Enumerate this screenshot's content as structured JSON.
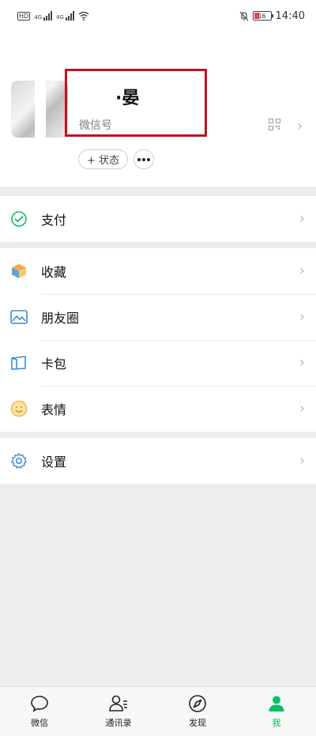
{
  "status_bar": {
    "network_badge": "HD",
    "signal_1": "4G",
    "signal_2": "4G",
    "battery": "16",
    "time": "14:40"
  },
  "profile": {
    "nickname": "·晏",
    "wechat_id_label": "微信号",
    "status_button_label": "+ 状态",
    "accent_highlight": "#c1121f"
  },
  "menu": {
    "pay": {
      "label": "支付",
      "icon": "pay-icon"
    },
    "favorites": {
      "label": "收藏",
      "icon": "box-icon"
    },
    "moments": {
      "label": "朋友圈",
      "icon": "picture-icon"
    },
    "cards": {
      "label": "卡包",
      "icon": "wallet-icon"
    },
    "stickers": {
      "label": "表情",
      "icon": "smiley-icon"
    },
    "settings": {
      "label": "设置",
      "icon": "gear-icon"
    }
  },
  "tabs": [
    {
      "label": "微信",
      "icon": "chat-bubble-icon"
    },
    {
      "label": "通讯录",
      "icon": "contacts-icon"
    },
    {
      "label": "发现",
      "icon": "compass-icon"
    },
    {
      "label": "我",
      "icon": "person-icon",
      "active": true
    }
  ],
  "colors": {
    "brand_green": "#07c160",
    "background": "#ededed",
    "chevron": "#b8b8b8"
  }
}
